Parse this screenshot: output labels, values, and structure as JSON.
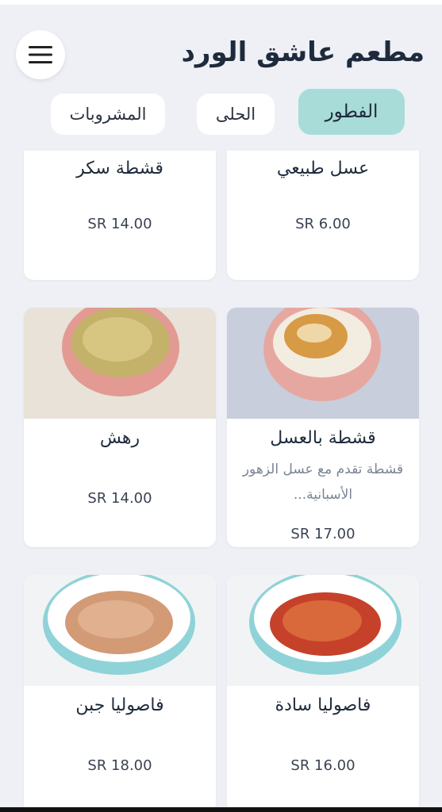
{
  "header": {
    "title": "مطعم عاشق الورد",
    "menu_icon": "hamburger-menu-icon"
  },
  "tabs": [
    {
      "label": "الفطور",
      "active": true
    },
    {
      "label": "الحلى",
      "active": false
    },
    {
      "label": "المشروبات",
      "active": false
    }
  ],
  "items": [
    {
      "name": "عسل طبيعي",
      "price": "SR 6.00"
    },
    {
      "name": "قشطة سكر",
      "price": "SR 14.00"
    },
    {
      "name": "قشطة بالعسل",
      "description": "قشطة تقدم مع عسل الزهور الأسبانية...",
      "price": "SR 17.00"
    },
    {
      "name": "رهش",
      "price": "SR 14.00"
    },
    {
      "name": "فاصوليا سادة",
      "price": "SR 16.00"
    },
    {
      "name": "فاصوليا جبن",
      "price": "SR 18.00"
    }
  ],
  "colors": {
    "background": "#eef0f6",
    "active_tab": "#a7dcd9",
    "card": "#ffffff"
  }
}
